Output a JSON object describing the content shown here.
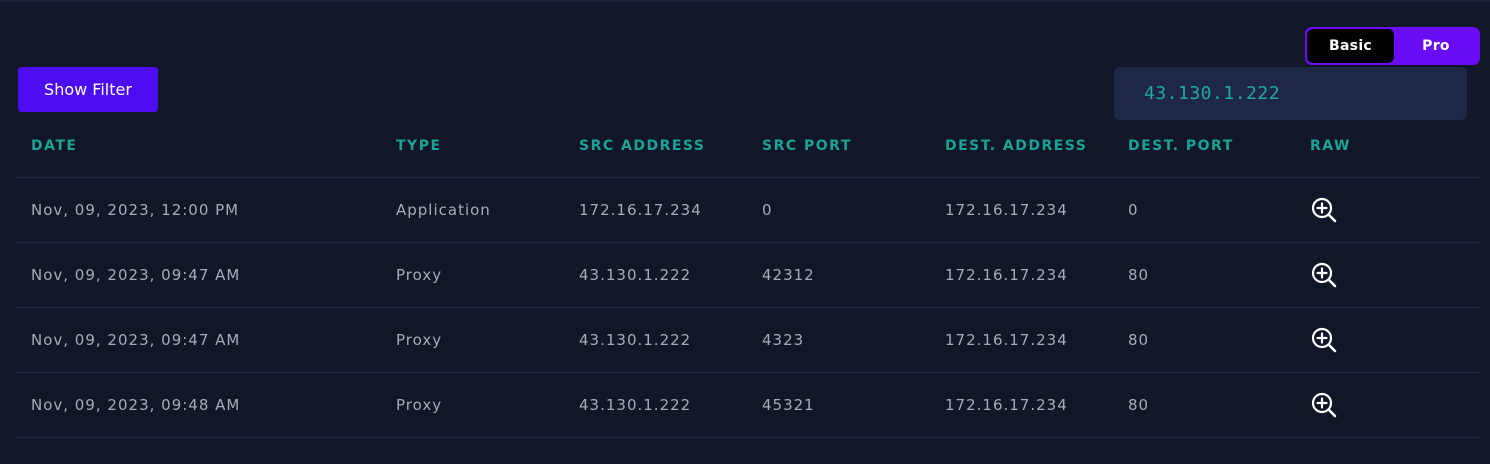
{
  "mode_toggle": {
    "basic_label": "Basic",
    "pro_label": "Pro",
    "active": "Basic"
  },
  "filter_button_label": "Show Filter",
  "search": {
    "value": "43.130.1.222"
  },
  "table": {
    "headers": {
      "date": "DATE",
      "type": "TYPE",
      "src_address": "SRC ADDRESS",
      "src_port": "SRC PORT",
      "dest_address": "DEST. ADDRESS",
      "dest_port": "DEST. PORT",
      "raw": "RAW"
    },
    "rows": [
      {
        "date": "Nov, 09, 2023, 12:00 PM",
        "type": "Application",
        "src_address": "172.16.17.234",
        "src_port": "0",
        "dest_address": "172.16.17.234",
        "dest_port": "0",
        "raw_icon": "zoom-in-icon"
      },
      {
        "date": "Nov, 09, 2023, 09:47 AM",
        "type": "Proxy",
        "src_address": "43.130.1.222",
        "src_port": "42312",
        "dest_address": "172.16.17.234",
        "dest_port": "80",
        "raw_icon": "zoom-in-icon"
      },
      {
        "date": "Nov, 09, 2023, 09:47 AM",
        "type": "Proxy",
        "src_address": "43.130.1.222",
        "src_port": "4323",
        "dest_address": "172.16.17.234",
        "dest_port": "80",
        "raw_icon": "zoom-in-icon"
      },
      {
        "date": "Nov, 09, 2023, 09:48 AM",
        "type": "Proxy",
        "src_address": "43.130.1.222",
        "src_port": "45321",
        "dest_address": "172.16.17.234",
        "dest_port": "80",
        "raw_icon": "zoom-in-icon"
      }
    ]
  },
  "colors": {
    "background": "#111629",
    "accent_purple": "#6a0cf5",
    "button_purple": "#4c0bf0",
    "header_teal": "#1aa395",
    "search_text": "#21a8a0",
    "search_bg": "#1f2746",
    "cell_text": "#a8abb8"
  }
}
